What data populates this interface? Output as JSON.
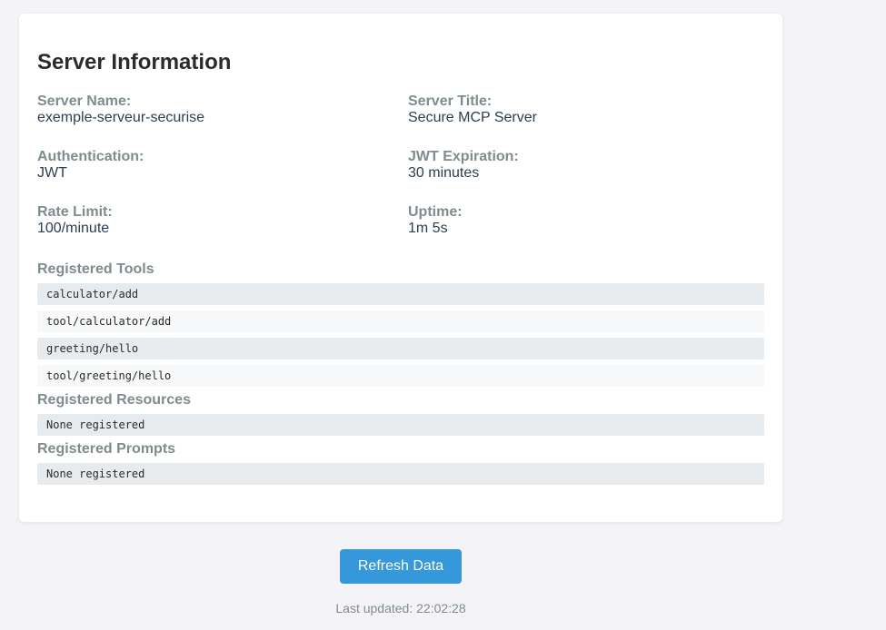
{
  "server_info": {
    "title": "Server Information",
    "fields": [
      {
        "label": "Server Name:",
        "value": "exemple-serveur-securise"
      },
      {
        "label": "Server Title:",
        "value": "Secure MCP Server"
      },
      {
        "label": "Authentication:",
        "value": "JWT"
      },
      {
        "label": "JWT Expiration:",
        "value": "30 minutes"
      },
      {
        "label": "Rate Limit:",
        "value": "100/minute"
      },
      {
        "label": "Uptime:",
        "value": "1m 5s"
      }
    ]
  },
  "tools": {
    "title": "Registered Tools",
    "items": [
      "calculator/add",
      "tool/calculator/add",
      "greeting/hello",
      "tool/greeting/hello"
    ]
  },
  "resources": {
    "title": "Registered Resources",
    "items": [
      "None registered"
    ]
  },
  "prompts": {
    "title": "Registered Prompts",
    "items": [
      "None registered"
    ]
  },
  "refresh_label": "Refresh Data",
  "last_updated_label": "Last updated:",
  "last_updated_time": "22:02:28",
  "colors": {
    "accent": "#3498db",
    "label": "#7f8c8d",
    "text": "#2c3e50"
  }
}
